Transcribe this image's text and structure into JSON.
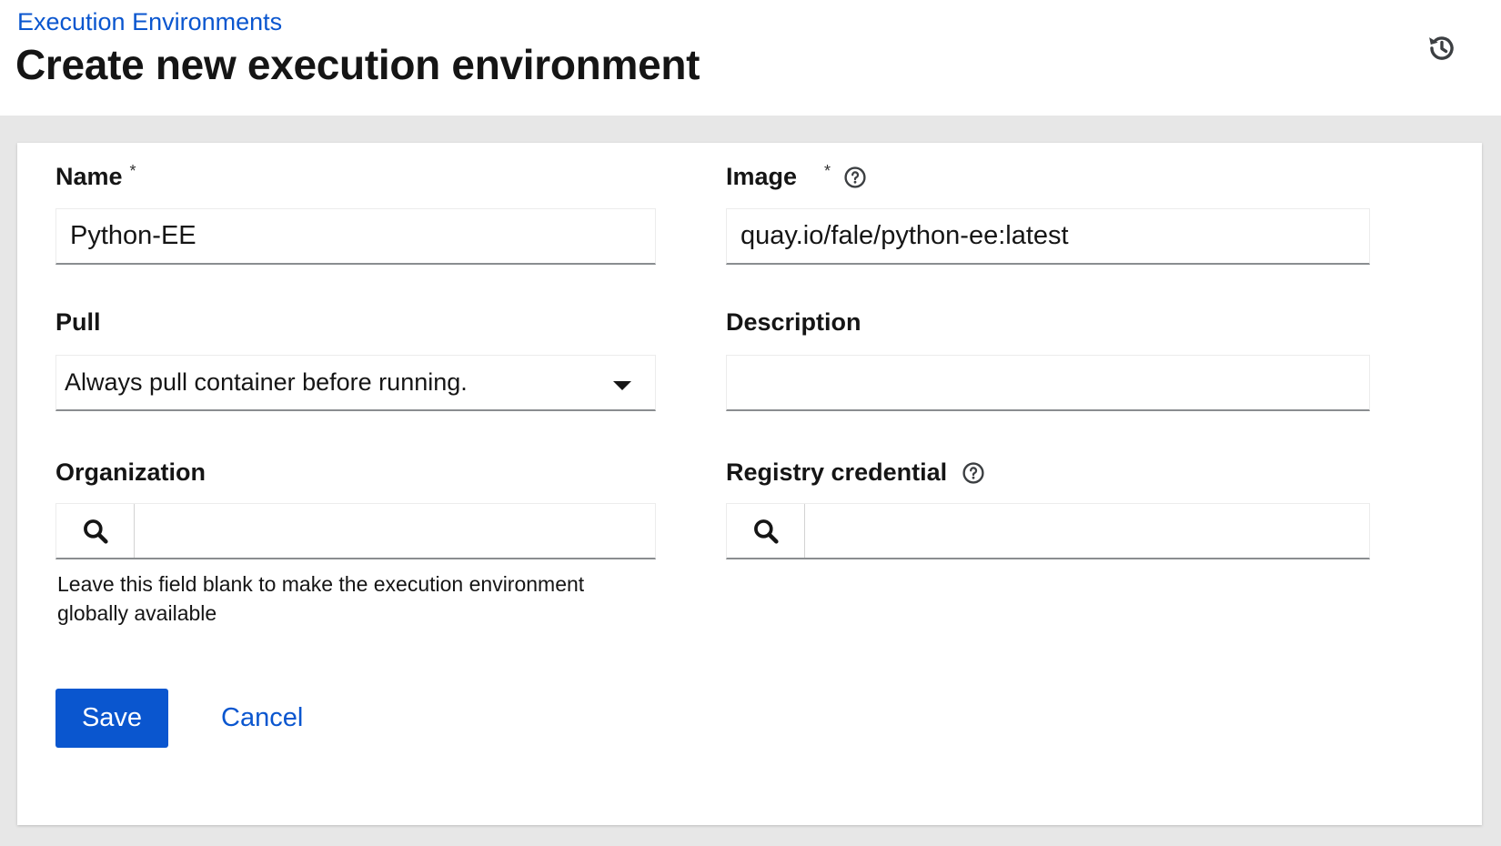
{
  "header": {
    "breadcrumb": "Execution Environments",
    "title": "Create new execution environment",
    "history_icon": "history-icon"
  },
  "form": {
    "name": {
      "label": "Name",
      "required_mark": "*",
      "value": "Python-EE"
    },
    "image": {
      "label": "Image",
      "required_mark": "*",
      "help_icon": "question-circle-icon",
      "value": "quay.io/fale/python-ee:latest"
    },
    "pull": {
      "label": "Pull",
      "selected": "Always pull container before running."
    },
    "description": {
      "label": "Description",
      "value": ""
    },
    "organization": {
      "label": "Organization",
      "search_icon": "search-icon",
      "value": "",
      "helper": "Leave this field blank to make the execution environment globally available"
    },
    "registry_credential": {
      "label": "Registry credential",
      "help_icon": "question-circle-icon",
      "search_icon": "search-icon",
      "value": ""
    }
  },
  "actions": {
    "save_label": "Save",
    "cancel_label": "Cancel"
  },
  "colors": {
    "primary": "#0a56cf",
    "page_background": "#e7e7e7",
    "text": "#151515"
  }
}
